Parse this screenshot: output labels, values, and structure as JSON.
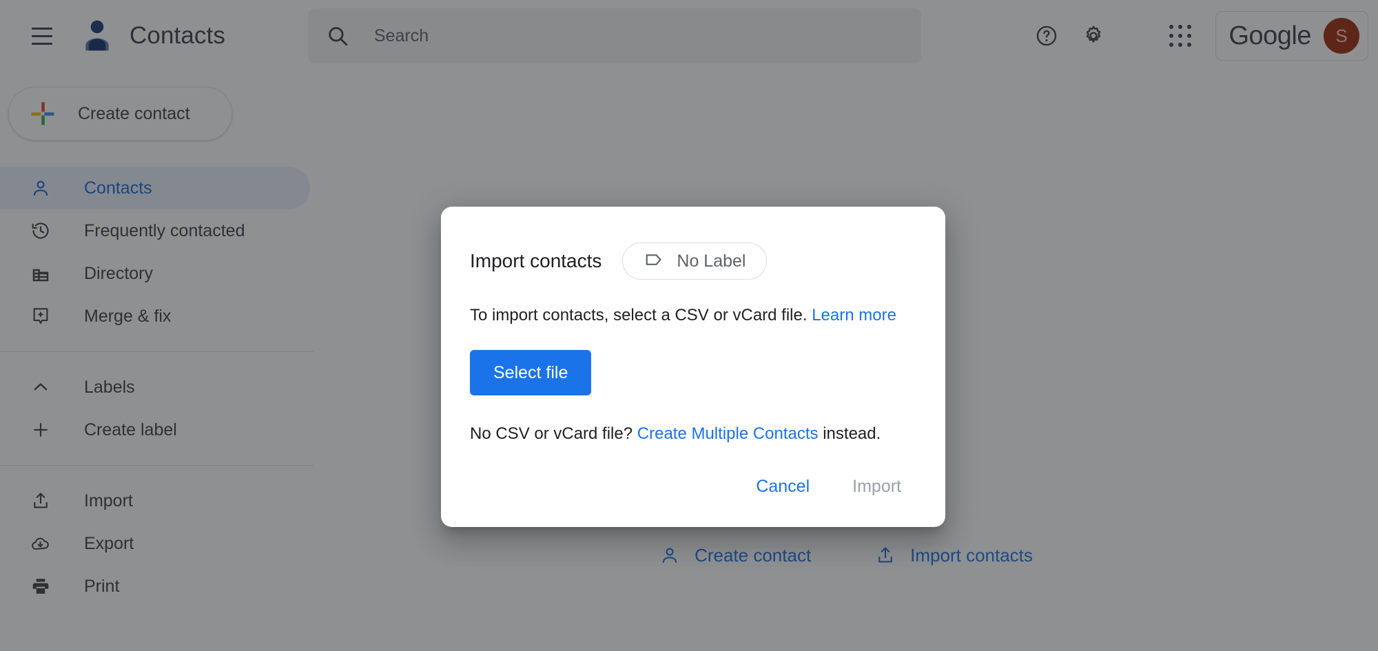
{
  "app": {
    "title": "Contacts",
    "accent_blue": "#1a73e8",
    "active_nav_bg": "#e8f0fe",
    "scrim_color": "rgba(32,33,36,0.50)"
  },
  "topbar": {
    "menu_label": "Main menu",
    "logo_name": "contacts-logo",
    "search": {
      "placeholder": "Search",
      "value": ""
    },
    "help_label": "Support",
    "settings_label": "Settings",
    "apps_label": "Google apps",
    "account": {
      "brand": "Google",
      "avatar_initial": "S",
      "avatar_color": "#9c2a0f"
    }
  },
  "sidebar": {
    "create_contact": "Create contact",
    "items": [
      {
        "label": "Contacts",
        "icon": "person-icon",
        "active": true
      },
      {
        "label": "Frequently contacted",
        "icon": "history-icon",
        "active": false
      },
      {
        "label": "Directory",
        "icon": "building-icon",
        "active": false
      },
      {
        "label": "Merge & fix",
        "icon": "merge-fix-icon",
        "active": false
      }
    ],
    "labels_header": "Labels",
    "create_label": "Create label",
    "tools": [
      {
        "label": "Import",
        "icon": "import-icon"
      },
      {
        "label": "Export",
        "icon": "export-icon"
      },
      {
        "label": "Print",
        "icon": "print-icon"
      }
    ]
  },
  "main": {
    "empty_actions": [
      {
        "label": "Create contact",
        "icon": "person-icon"
      },
      {
        "label": "Import contacts",
        "icon": "import-icon"
      }
    ]
  },
  "dialog": {
    "title": "Import contacts",
    "label_chip": "No Label",
    "description_prefix": "To import contacts, select a CSV or vCard file.",
    "learn_more": "Learn more",
    "select_file": "Select file",
    "note_prefix": "No CSV or vCard file?",
    "note_link": "Create Multiple Contacts",
    "note_suffix": "instead.",
    "cancel": "Cancel",
    "import": "Import"
  }
}
